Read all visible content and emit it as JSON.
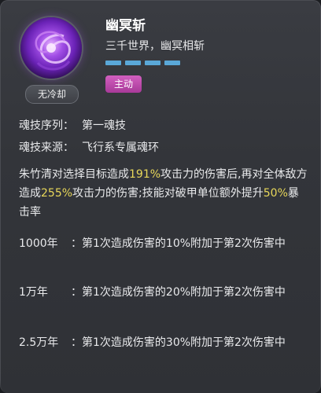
{
  "skill": {
    "name": "幽冥斩",
    "subtitle": "三千世界，幽冥相斩",
    "tag": "主动",
    "cooldown": "无冷却",
    "bar_count": 4,
    "bar_color": "#5aa8d8",
    "icon": "purple-vortex-icon"
  },
  "info": {
    "sequence_label": "魂技序列：",
    "sequence_value": "第一魂技",
    "source_label": "魂技来源：",
    "source_value": "飞行系专属魂环"
  },
  "description": {
    "p1": "朱竹清对选择目标造成",
    "v1": "191%",
    "p2": "攻击力的伤害后,再对全体敌方造成",
    "v2": "255%",
    "p3": "攻击力的伤害;技能对破甲单位额外提升",
    "v3": "50%",
    "p4": "暴击率"
  },
  "levels": [
    {
      "year": "1000年",
      "colon": "：",
      "text": "第1次造成伤害的10%附加于第2次伤害中"
    },
    {
      "year": "1万年",
      "colon": "：",
      "text": "第1次造成伤害的20%附加于第2次伤害中"
    },
    {
      "year": "2.5万年",
      "colon": "：",
      "text": "第1次造成伤害的30%附加于第2次伤害中"
    }
  ],
  "highlight_color": "#e8d75a"
}
